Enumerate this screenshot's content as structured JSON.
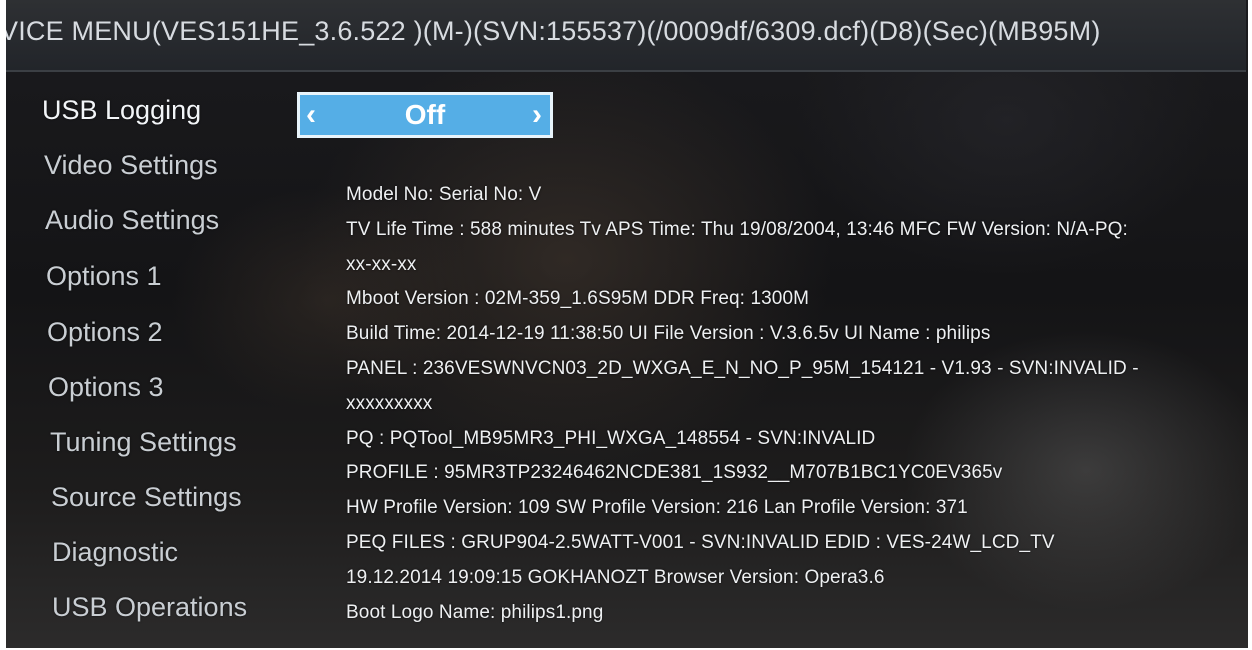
{
  "header": {
    "title": "VICE MENU(VES151HE_3.6.522 )(M-)(SVN:155537)(/0009df/6309.dcf)(D8)(Sec)(MB95M)"
  },
  "menu": {
    "items": [
      {
        "label": "USB Logging"
      },
      {
        "label": "Video Settings"
      },
      {
        "label": "Audio Settings"
      },
      {
        "label": "Options 1"
      },
      {
        "label": "Options 2"
      },
      {
        "label": "Options 3"
      },
      {
        "label": "Tuning Settings"
      },
      {
        "label": "Source Settings"
      },
      {
        "label": "Diagnostic"
      },
      {
        "label": "USB Operations"
      }
    ],
    "selected_index": 0
  },
  "usb_logging": {
    "value": "Off",
    "left_arrow": "‹",
    "right_arrow": "›"
  },
  "info": {
    "lines": [
      "Model No:   Serial No: V",
      "TV Life Time : 588 minutes  Tv APS Time: Thu 19/08/2004, 13:46 MFC FW Version: N/A-PQ:",
      "xx-xx-xx",
      "Mboot Version : 02M-359_1.6S95M  DDR Freq: 1300M",
      "Build Time: 2014-12-19 11:38:50  UI File Version : V.3.6.5v  UI Name : philips",
      "PANEL : 236VESWNVCN03_2D_WXGA_E_N_NO_P_95M_154121 - V1.93 - SVN:INVALID -",
      "xxxxxxxxx",
      "PQ : PQTool_MB95MR3_PHI_WXGA_148554 - SVN:INVALID",
      "PROFILE : 95MR3TP23246462NCDE381_1S932__M707B1BC1YC0EV365v",
      "HW Profile Version: 109  SW Profile Version: 216  Lan Profile Version: 371",
      "PEQ FILES : GRUP904-2.5WATT-V001 - SVN:INVALID    EDID : VES-24W_LCD_TV",
      "19.12.2014 19:09:15 GOKHANOZT  Browser Version: Opera3.6",
      "Boot Logo Name: philips1.png"
    ]
  },
  "colors": {
    "selector_bg": "#55aee6",
    "selector_border": "#e8f4fb",
    "text": "#eef0f2",
    "header_bg": "#2a2d31"
  }
}
